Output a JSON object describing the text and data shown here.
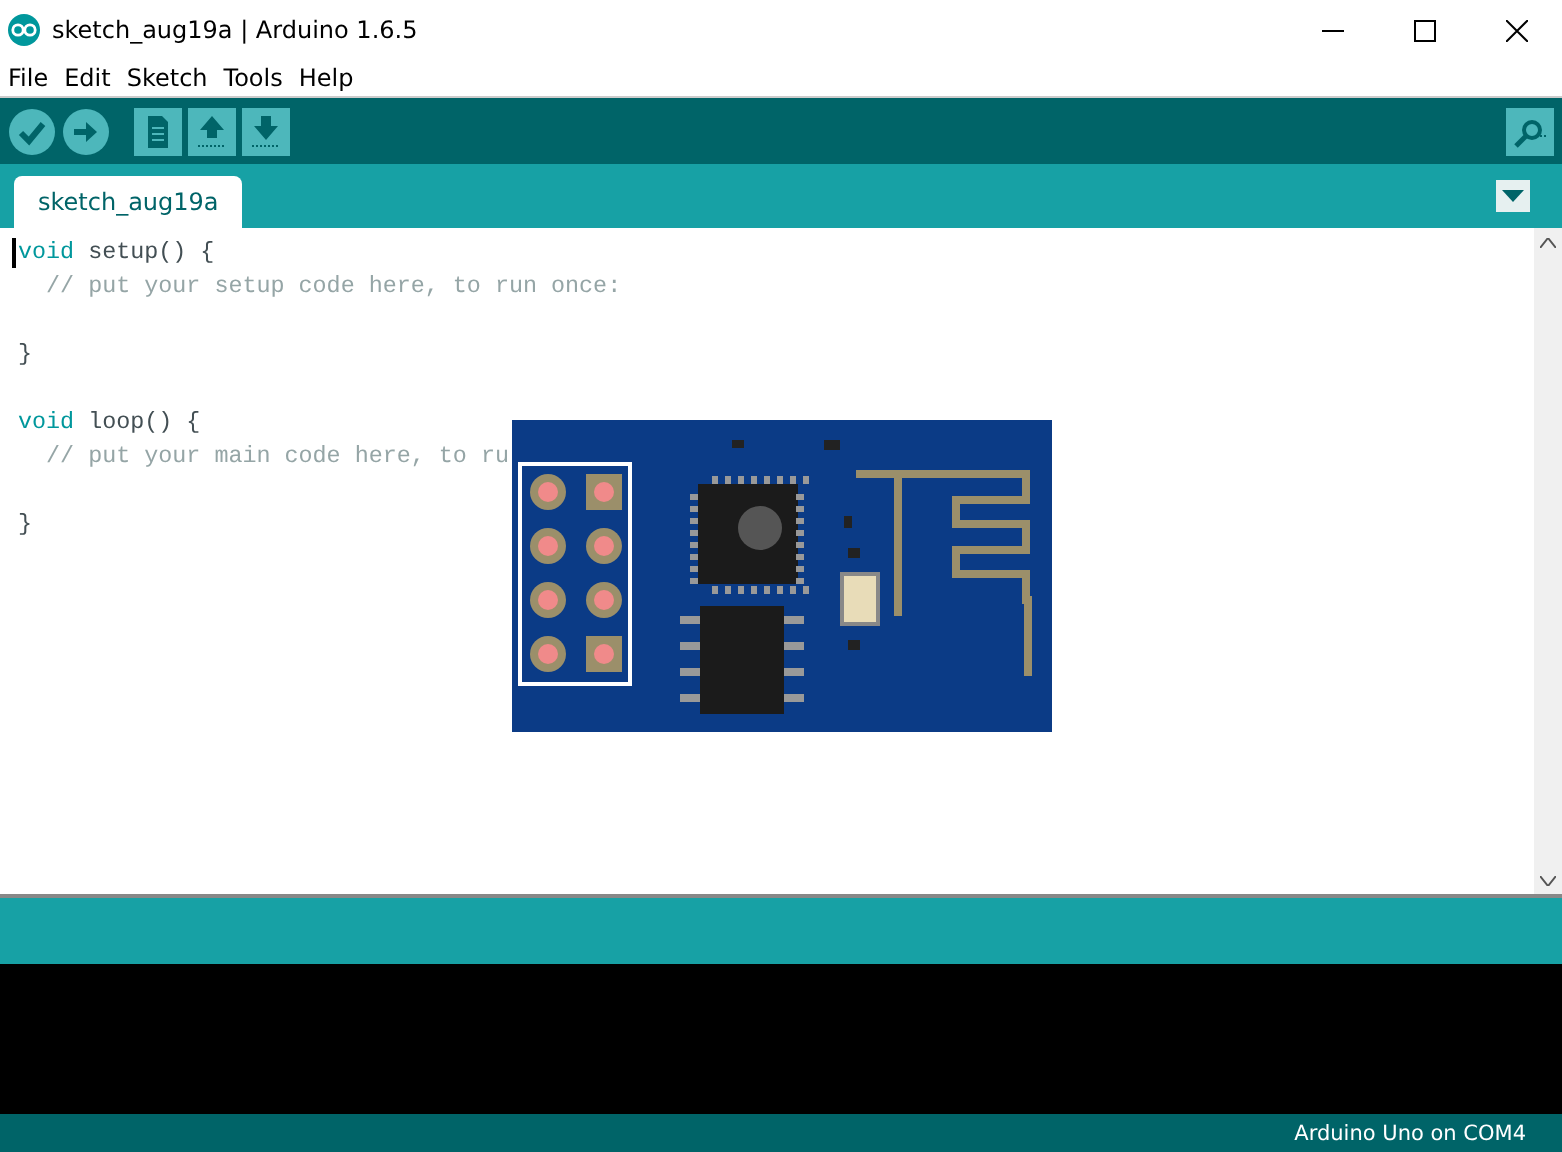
{
  "window": {
    "title": "sketch_aug19a | Arduino 1.6.5"
  },
  "menu": [
    "File",
    "Edit",
    "Sketch",
    "Tools",
    "Help"
  ],
  "tabs": [
    {
      "label": "sketch_aug19a",
      "selected": true
    }
  ],
  "editor": {
    "lines": [
      {
        "kind": "code",
        "keyword": "void",
        "text": " setup() {"
      },
      {
        "kind": "comment",
        "text": "  // put your setup code here, to run once:"
      },
      {
        "kind": "blank"
      },
      {
        "kind": "code",
        "text": "}"
      },
      {
        "kind": "blank"
      },
      {
        "kind": "code",
        "keyword": "void",
        "text": " loop() {"
      },
      {
        "kind": "comment",
        "text": "  // put your main code here, to ru"
      },
      {
        "kind": "blank"
      },
      {
        "kind": "code",
        "text": "}"
      }
    ]
  },
  "status_bar": {
    "board": "Arduino Uno on COM4"
  }
}
